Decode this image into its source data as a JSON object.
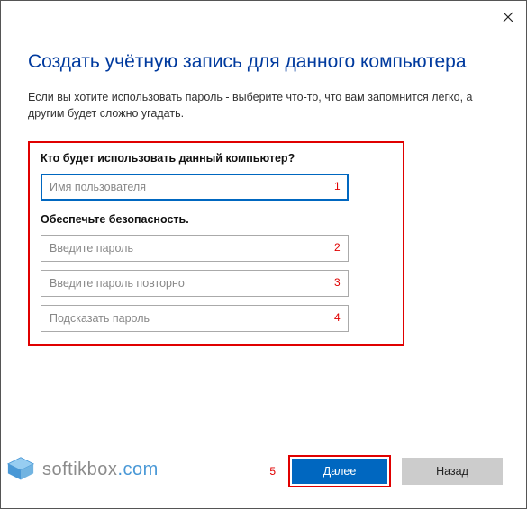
{
  "title": "Создать учётную запись для данного компьютера",
  "subtitle": "Если вы хотите использовать пароль - выберите что-то, что вам запомнится легко, а другим будет сложно угадать.",
  "section1_label": "Кто будет использовать данный компьютер?",
  "section2_label": "Обеспечьте безопасность.",
  "fields": {
    "username": {
      "placeholder": "Имя пользователя",
      "value": ""
    },
    "password": {
      "placeholder": "Введите пароль",
      "value": ""
    },
    "password2": {
      "placeholder": "Введите пароль повторно",
      "value": ""
    },
    "hint": {
      "placeholder": "Подсказать пароль",
      "value": ""
    }
  },
  "markers": {
    "m1": "1",
    "m2": "2",
    "m3": "3",
    "m4": "4",
    "m5": "5"
  },
  "buttons": {
    "next": "Далее",
    "back": "Назад"
  },
  "watermark": {
    "brand": "softikbox",
    "domain": ".com"
  }
}
